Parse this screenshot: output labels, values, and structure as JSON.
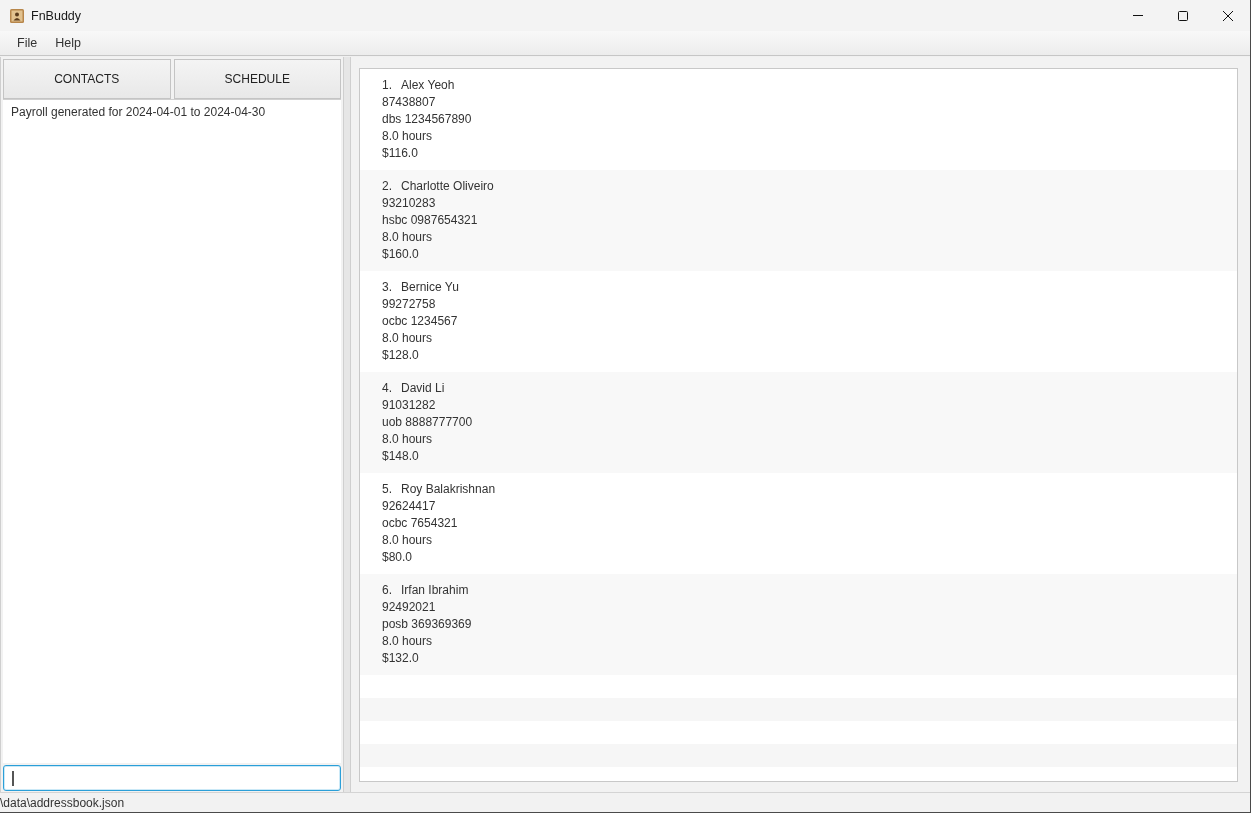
{
  "window": {
    "title": "FnBuddy"
  },
  "menu": [
    "File",
    "Help"
  ],
  "view_buttons": [
    "CONTACTS",
    "SCHEDULE"
  ],
  "result_display": {
    "text": "Payroll generated for 2024-04-01 to 2024-04-30"
  },
  "command_box": {
    "focused": true
  },
  "persons": [
    {
      "index": "1.",
      "name": "Alex Yeoh",
      "phone": "87438807",
      "bank": "dbs 1234567890",
      "hours": "8.0 hours",
      "pay": "$116.0"
    },
    {
      "index": "2.",
      "name": "Charlotte Oliveiro",
      "phone": "93210283",
      "bank": "hsbc 0987654321",
      "hours": "8.0 hours",
      "pay": "$160.0"
    },
    {
      "index": "3.",
      "name": "Bernice Yu",
      "phone": "99272758",
      "bank": "ocbc 1234567",
      "hours": "8.0 hours",
      "pay": "$128.0"
    },
    {
      "index": "4.",
      "name": "David Li",
      "phone": "91031282",
      "bank": "uob 8888777700",
      "hours": "8.0 hours",
      "pay": "$148.0"
    },
    {
      "index": "5.",
      "name": "Roy Balakrishnan",
      "phone": "92624417",
      "bank": "ocbc 7654321",
      "hours": "8.0 hours",
      "pay": "$80.0"
    },
    {
      "index": "6.",
      "name": "Irfan Ibrahim",
      "phone": "92492021",
      "bank": "posb 369369369",
      "hours": "8.0 hours",
      "pay": "$132.0"
    }
  ],
  "status_bar": {
    "path": "\\data\\addressbook.json"
  }
}
